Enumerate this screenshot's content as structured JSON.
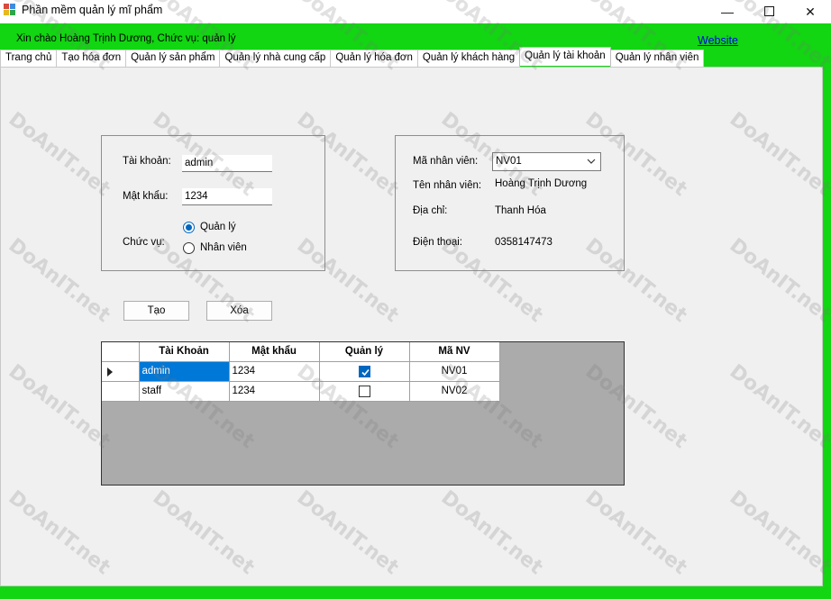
{
  "window": {
    "title": "Phần mềm quản lý mĩ phẩm",
    "minimize_glyph": "—",
    "maximize_glyph": "☐",
    "close_glyph": "✕"
  },
  "header": {
    "greeting": "Xin chào Hoàng Trịnh Dương, Chức vụ: quản lý",
    "website_link": "Website"
  },
  "tabs": [
    {
      "label": "Trang chủ",
      "active": false
    },
    {
      "label": "Tạo hóa đơn",
      "active": false
    },
    {
      "label": "Quản lý sản phẩm",
      "active": false
    },
    {
      "label": "Quản lý nhà cung cấp",
      "active": false
    },
    {
      "label": "Quản lý hóa đơn",
      "active": false
    },
    {
      "label": "Quản lý khách hàng",
      "active": false
    },
    {
      "label": "Quản lý tài khoản",
      "active": true
    },
    {
      "label": "Quản lý nhân viên",
      "active": false
    }
  ],
  "account_form": {
    "account_label": "Tài khoản:",
    "account_value": "admin",
    "password_label": "Mật khẩu:",
    "password_value": "1234",
    "role_label": "Chức vụ:",
    "role_options": [
      {
        "label": "Quản lý",
        "checked": true
      },
      {
        "label": "Nhân viên",
        "checked": false
      }
    ]
  },
  "employee_info": {
    "id_label": "Mã nhân viên:",
    "id_value": "NV01",
    "name_label": "Tên nhân viên:",
    "name_value": "Hoàng Trịnh Dương",
    "address_label": "Địa chỉ:",
    "address_value": "Thanh Hóa",
    "phone_label": "Điện thoại:",
    "phone_value": "0358147473"
  },
  "buttons": {
    "create": "Tạo",
    "delete": "Xóa"
  },
  "grid": {
    "columns": [
      "Tài Khoản",
      "Mật khẩu",
      "Quản lý",
      "Mã NV"
    ],
    "rows": [
      {
        "account": "admin",
        "password": "1234",
        "is_manager": true,
        "employee_id": "NV01",
        "selected": true
      },
      {
        "account": "staff",
        "password": "1234",
        "is_manager": false,
        "employee_id": "NV02",
        "selected": false
      }
    ]
  },
  "watermark": "DoAnIT.net",
  "colors": {
    "frame_green": "#11d611",
    "selection_blue": "#0078d7",
    "link_blue": "#0000ee",
    "grid_background": "#ababab"
  }
}
